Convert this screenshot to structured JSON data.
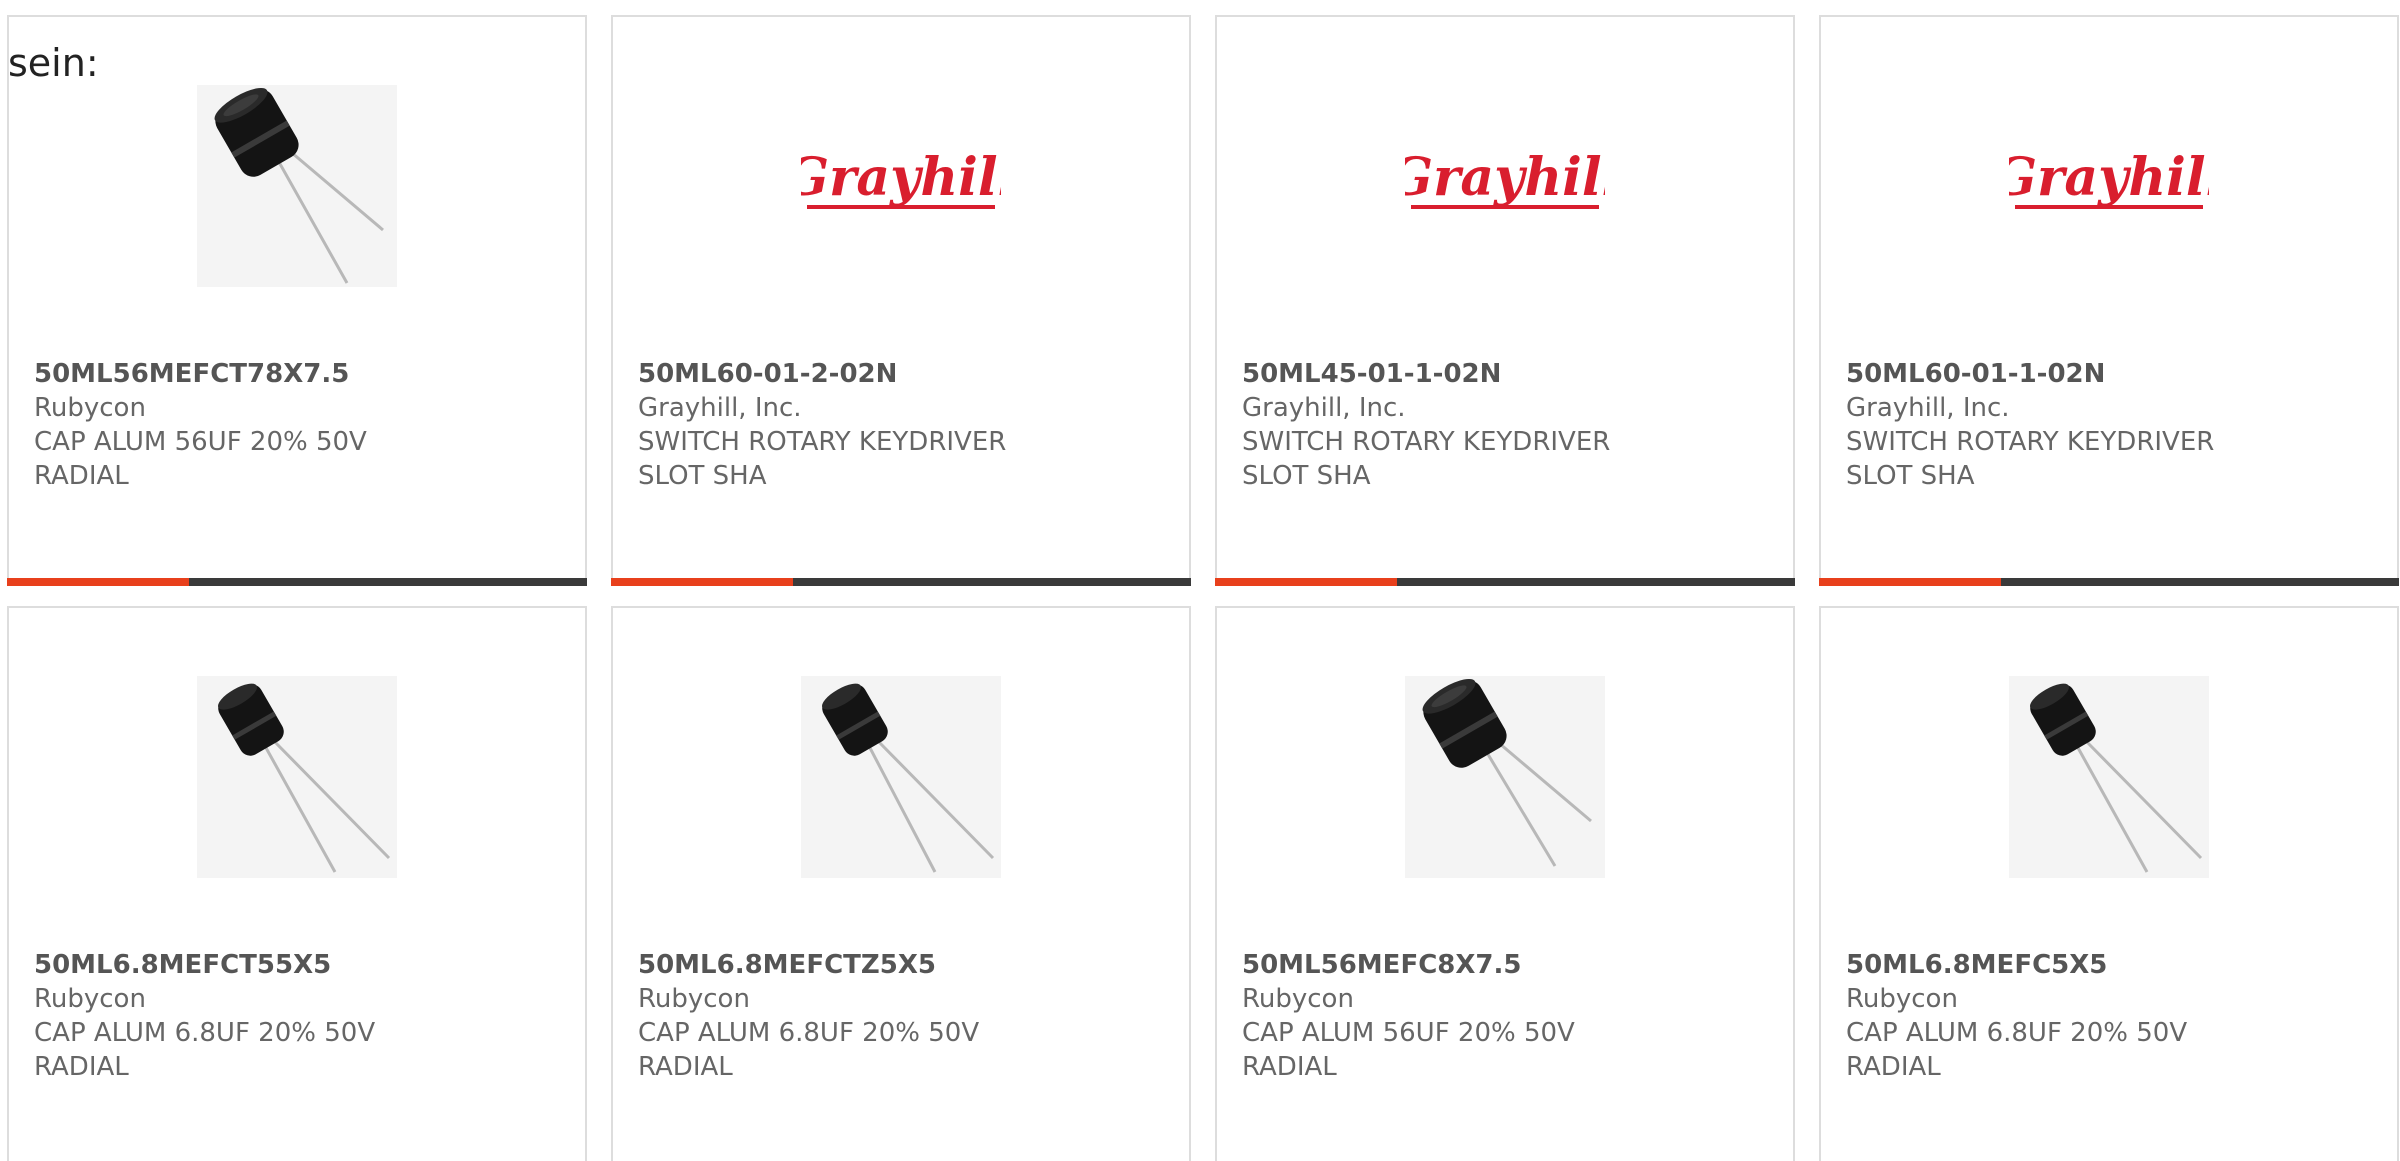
{
  "intro_text": "sein:",
  "colors": {
    "accent": "#e8401c",
    "bar": "#3a3a3a",
    "border": "#dddddd",
    "text": "#666666",
    "brand_red": "#d91e2e"
  },
  "products": [
    {
      "part": "50ML56MEFCT78X7.5",
      "maker": "Rubycon",
      "desc_line1": "CAP ALUM 56UF 20% 50V",
      "desc_line2": "RADIAL",
      "image": "capacitor-icon"
    },
    {
      "part": "50ML60-01-2-02N",
      "maker": "Grayhill, Inc.",
      "desc_line1": "SWITCH ROTARY KEYDRIVER",
      "desc_line2": "SLOT SHA",
      "image": "grayhill-logo",
      "logo_text": "Grayhill"
    },
    {
      "part": "50ML45-01-1-02N",
      "maker": "Grayhill, Inc.",
      "desc_line1": "SWITCH ROTARY KEYDRIVER",
      "desc_line2": "SLOT SHA",
      "image": "grayhill-logo",
      "logo_text": "Grayhill"
    },
    {
      "part": "50ML60-01-1-02N",
      "maker": "Grayhill, Inc.",
      "desc_line1": "SWITCH ROTARY KEYDRIVER",
      "desc_line2": "SLOT SHA",
      "image": "grayhill-logo",
      "logo_text": "Grayhill"
    },
    {
      "part": "50ML6.8MEFCT55X5",
      "maker": "Rubycon",
      "desc_line1": "CAP ALUM 6.8UF 20% 50V",
      "desc_line2": "RADIAL",
      "image": "capacitor-icon"
    },
    {
      "part": "50ML6.8MEFCTZ5X5",
      "maker": "Rubycon",
      "desc_line1": "CAP ALUM 6.8UF 20% 50V",
      "desc_line2": "RADIAL",
      "image": "capacitor-icon"
    },
    {
      "part": "50ML56MEFC8X7.5",
      "maker": "Rubycon",
      "desc_line1": "CAP ALUM 56UF 20% 50V",
      "desc_line2": "RADIAL",
      "image": "capacitor-icon"
    },
    {
      "part": "50ML6.8MEFC5X5",
      "maker": "Rubycon",
      "desc_line1": "CAP ALUM 6.8UF 20% 50V",
      "desc_line2": "RADIAL",
      "image": "capacitor-icon"
    }
  ]
}
